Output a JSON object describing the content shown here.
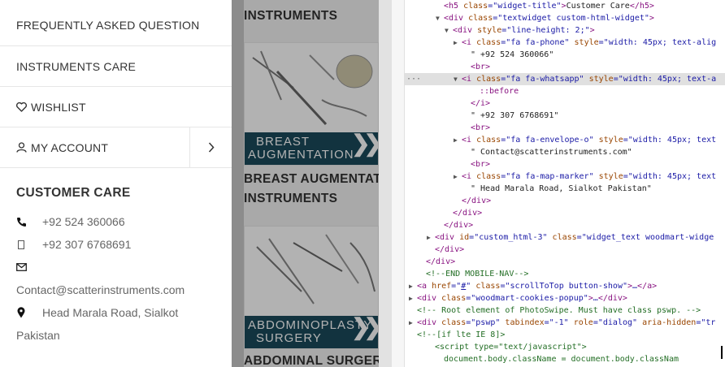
{
  "menu": {
    "items": [
      {
        "label": "FREQUENTLY ASKED QUESTION"
      },
      {
        "label": "INSTRUMENTS CARE"
      },
      {
        "label": "WISHLIST",
        "icon": "heart-icon"
      },
      {
        "label": "MY ACCOUNT",
        "icon": "user-icon",
        "submenu_icon": "chevron-right-icon"
      }
    ]
  },
  "customer_care": {
    "title": "CUSTOMER CARE",
    "phone": "+92 524 360066",
    "whatsapp": "+92 307 6768691",
    "email": "Contact@scatterinstruments.com",
    "address_line1": "Head Marala Road, Sialkot",
    "address_line2": "Pakistan"
  },
  "page": {
    "title_top": "INSTRUMENTS",
    "banner1": {
      "line1": "BREAST",
      "line2": "AUGMENTATION"
    },
    "title_mid1": "BREAST AUGMENTATION",
    "title_mid2": "INSTRUMENTS",
    "banner2": {
      "line1": "ABDOMINOPLASTY",
      "line2": "SURGERY"
    },
    "title_bottom": "ABDOMINAL SURGERY"
  },
  "devtools": {
    "lines": [
      {
        "indent": 4,
        "html": "<span class='t'>&lt;h5</span> <span class='an'>class</span>=<span class='av'>\"widget-title\"</span><span class='t'>&gt;</span><span class='tx'>Customer Care</span><span class='t'>&lt;/h5&gt;</span>"
      },
      {
        "indent": 4,
        "arrow": "▼",
        "html": "<span class='t'>&lt;div</span> <span class='an'>class</span>=<span class='av'>\"textwidget custom-html-widget\"</span><span class='t'>&gt;</span>"
      },
      {
        "indent": 5,
        "arrow": "▼",
        "html": "<span class='t'>&lt;div</span> <span class='an'>style</span>=<span class='av'>\"line-height: 2;\"</span><span class='t'>&gt;</span>"
      },
      {
        "indent": 6,
        "arrow": "▶",
        "html": "<span class='t'>&lt;i</span> <span class='an'>class</span>=<span class='av'>\"fa fa-phone\"</span> <span class='an'>style</span>=<span class='av'>\"width: 45px; text-alig</span>"
      },
      {
        "indent": 7,
        "html": "<span class='tx'>\" +92 524 360066\"</span>"
      },
      {
        "indent": 7,
        "html": "<span class='t'>&lt;br&gt;</span>"
      },
      {
        "indent": 6,
        "arrow": "▼",
        "sel": true,
        "html": "<span class='t'>&lt;i</span> <span class='an'>class</span>=<span class='av'>\"fa fa-whatsapp\"</span> <span class='an'>style</span>=<span class='av'>\"width: 45px; text-a</span>"
      },
      {
        "indent": 8,
        "html": "<span class='t'>::before</span>"
      },
      {
        "indent": 7,
        "html": "<span class='t'>&lt;/i&gt;</span>"
      },
      {
        "indent": 7,
        "html": "<span class='tx'>\" +92 307 6768691\"</span>"
      },
      {
        "indent": 7,
        "html": "<span class='t'>&lt;br&gt;</span>"
      },
      {
        "indent": 6,
        "arrow": "▶",
        "html": "<span class='t'>&lt;i</span> <span class='an'>class</span>=<span class='av'>\"fa fa-envelope-o\"</span> <span class='an'>style</span>=<span class='av'>\"width: 45px; text</span>"
      },
      {
        "indent": 7,
        "html": "<span class='tx'>\" Contact@scatterinstruments.com\"</span>"
      },
      {
        "indent": 7,
        "html": "<span class='t'>&lt;br&gt;</span>"
      },
      {
        "indent": 6,
        "arrow": "▶",
        "html": "<span class='t'>&lt;i</span> <span class='an'>class</span>=<span class='av'>\"fa fa-map-marker\"</span> <span class='an'>style</span>=<span class='av'>\"width: 45px; text</span>"
      },
      {
        "indent": 7,
        "html": "<span class='tx'>\" Head Marala Road, Sialkot Pakistan\"</span>"
      },
      {
        "indent": 6,
        "html": "<span class='t'>&lt;/div&gt;</span>"
      },
      {
        "indent": 5,
        "html": "<span class='t'>&lt;/div&gt;</span>"
      },
      {
        "indent": 4,
        "html": "<span class='t'>&lt;/div&gt;</span>"
      },
      {
        "indent": 3,
        "arrow": "▶",
        "html": "<span class='t'>&lt;div</span> <span class='an'>id</span>=<span class='av'>\"custom_html-3\"</span> <span class='an'>class</span>=<span class='av'>\"widget_text woodmart-widge</span>"
      },
      {
        "indent": 3,
        "html": "<span class='t'>&lt;/div&gt;</span>"
      },
      {
        "indent": 2,
        "html": "<span class='t'>&lt;/div&gt;</span>"
      },
      {
        "indent": 2,
        "html": "<span class='cm'>&lt;!--END MOBILE-NAV--&gt;</span>"
      },
      {
        "indent": 1,
        "arrow": "▶",
        "html": "<span class='t'>&lt;a</span> <span class='an'>href</span>=<span class='av'>\"<u>#</u>\"</span> <span class='an'>class</span>=<span class='av'>\"scrollToTop button-show\"</span><span class='t'>&gt;</span>…<span class='t'>&lt;/a&gt;</span>"
      },
      {
        "indent": 1,
        "arrow": "▶",
        "html": "<span class='t'>&lt;div</span> <span class='an'>class</span>=<span class='av'>\"woodmart-cookies-popup\"</span><span class='t'>&gt;</span>…<span class='t'>&lt;/div&gt;</span>"
      },
      {
        "indent": 1,
        "html": "<span class='cm'>&lt;!-- Root element of PhotoSwipe. Must have class pswp. --&gt;</span>"
      },
      {
        "indent": 1,
        "arrow": "▶",
        "html": "<span class='t'>&lt;div</span> <span class='an'>class</span>=<span class='av'>\"pswp\"</span> <span class='an'>tabindex</span>=<span class='av'>\"-1\"</span> <span class='an'>role</span>=<span class='av'>\"dialog\"</span> <span class='an'>aria-hidden</span>=<span class='av'>\"tr</span>"
      },
      {
        "indent": 1,
        "html": "<span class='cm'>&lt;!--[if lte IE 8]&gt;</span>"
      },
      {
        "indent": 3,
        "html": "<span class='cm'>&lt;script type=\"text/javascript\"&gt;</span>"
      },
      {
        "indent": 4,
        "html": "<span class='cm'>document.body.className = document.body.classNam</span>"
      },
      {
        "indent": 3,
        "html": "<span class='cm'>&lt;/script&gt;</span>"
      }
    ]
  }
}
